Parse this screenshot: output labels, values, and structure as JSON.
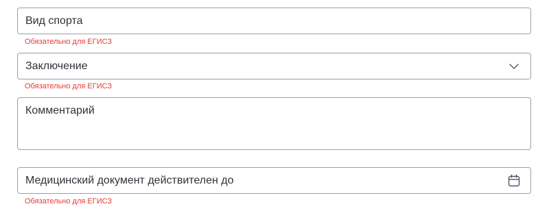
{
  "fields": {
    "sport": {
      "placeholder": "Вид спорта",
      "hint": "Обязательно для ЕГИСЗ"
    },
    "conclusion": {
      "placeholder": "Заключение",
      "hint": "Обязательно для ЕГИСЗ",
      "icon": "chevron-down-icon"
    },
    "comment": {
      "placeholder": "Комментарий"
    },
    "valid_until": {
      "placeholder": "Медицинский документ действителен до",
      "hint": "Обязательно для ЕГИСЗ",
      "icon": "calendar-icon"
    }
  },
  "colors": {
    "border": "#9aa0a6",
    "hint": "#e53935",
    "text": "#2d333a"
  }
}
